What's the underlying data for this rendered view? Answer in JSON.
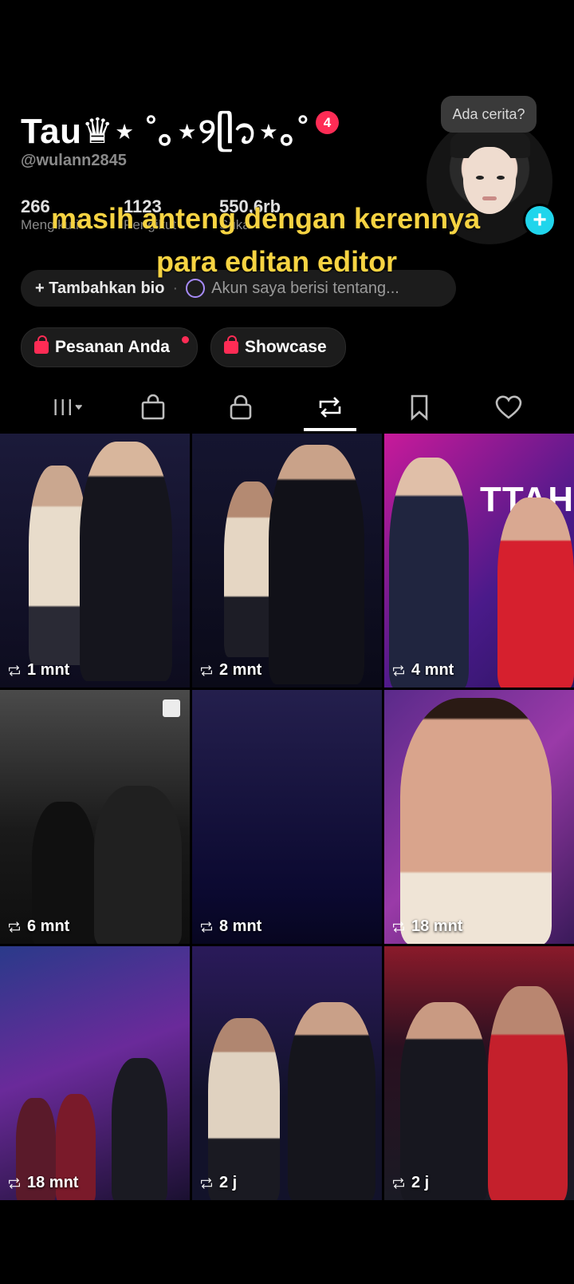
{
  "profile": {
    "display_name": "Tau♛⋆ ˚｡⋆୨ᥫ᭡⋆｡˚",
    "notification_count": "4",
    "handle": "@wulann2845",
    "story_prompt": "Ada cerita?",
    "add_button": "+",
    "stats": [
      {
        "value": "266",
        "label": "Mengikuti"
      },
      {
        "value": "1123",
        "label": "Pengikut"
      },
      {
        "value": "550,6rb",
        "label": "Suka"
      }
    ]
  },
  "caption": {
    "line1": "masih anteng dengan kerennya",
    "line2": "para editan editor"
  },
  "bio": {
    "add_label": "+ Tambahkan bio",
    "separator": "·",
    "placeholder": "Akun saya berisi tentang..."
  },
  "chips": [
    {
      "label": "Pesanan Anda"
    },
    {
      "label": "Showcase"
    }
  ],
  "tabs": [
    {
      "icon": "grid-icon"
    },
    {
      "icon": "shopping-bag-icon"
    },
    {
      "icon": "lock-icon"
    },
    {
      "icon": "repost-icon",
      "active": true
    },
    {
      "icon": "bookmark-icon"
    },
    {
      "icon": "heart-icon"
    }
  ],
  "grid": [
    {
      "time": "1 mnt"
    },
    {
      "time": "2 mnt"
    },
    {
      "time": "4 mnt",
      "overlay_text": "TTAH"
    },
    {
      "time": "6 mnt"
    },
    {
      "time": "8 mnt"
    },
    {
      "time": "18 mnt"
    },
    {
      "time": "18 mnt"
    },
    {
      "time": "2 j"
    },
    {
      "time": "2 j"
    }
  ],
  "colors": {
    "accent_red": "#fe2c55",
    "caption_yellow": "#f6d342",
    "plus_cyan": "#20d5ec"
  }
}
